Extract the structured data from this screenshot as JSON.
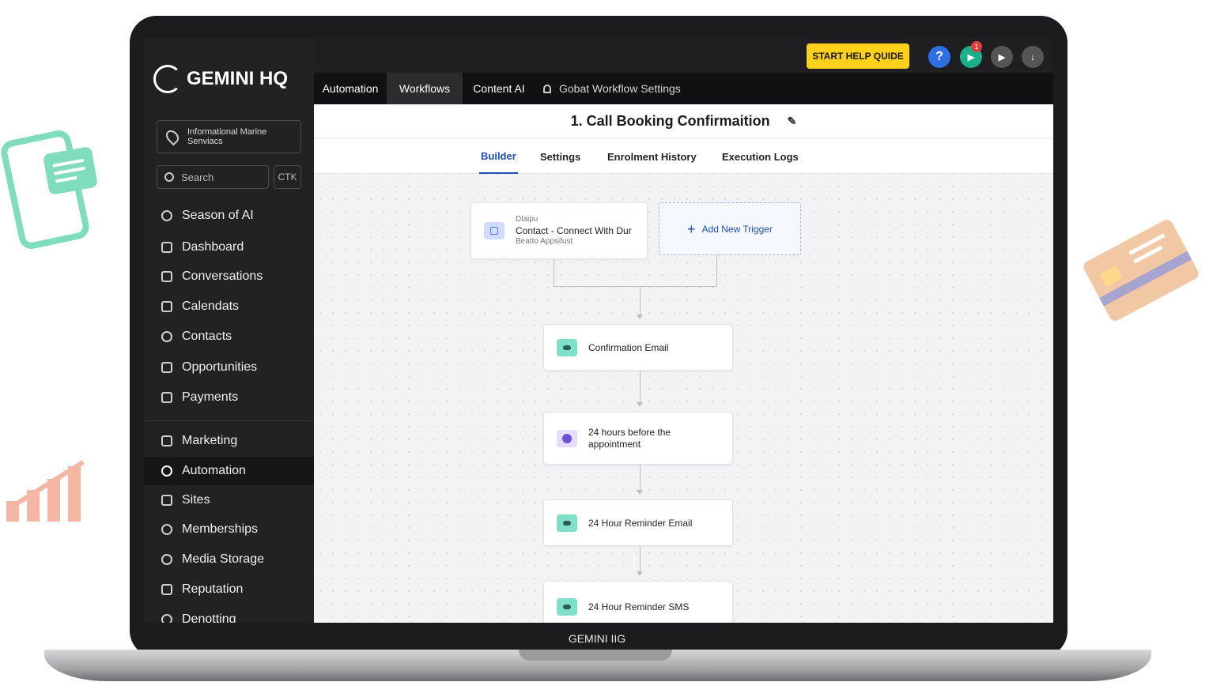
{
  "app": {
    "name": "GEMINI HQ",
    "laptop_label": "GEMINI IIG"
  },
  "topbar": {
    "help_button": "START HELP QUIDE",
    "notification_count": "1"
  },
  "sidebar": {
    "location": "Informational Marine Senviacs",
    "search_placeholder": "Search",
    "shortcut": "CTK",
    "items": [
      {
        "label": "Season of AI",
        "icon": "wifi-icon"
      },
      {
        "label": "Dashboard",
        "icon": "square-icon"
      },
      {
        "label": "Conversations",
        "icon": "square-icon"
      },
      {
        "label": "Calendats",
        "icon": "calendar-icon"
      },
      {
        "label": "Contacts",
        "icon": "person-icon"
      },
      {
        "label": "Opportunities",
        "icon": "square-icon"
      },
      {
        "label": "Payments",
        "icon": "monitor-icon"
      },
      {
        "label": "Marketing",
        "icon": "cart-icon"
      },
      {
        "label": "Automation",
        "icon": "circle-icon",
        "active": true
      },
      {
        "label": "Sites",
        "icon": "square-icon"
      },
      {
        "label": "Memberships",
        "icon": "person-icon"
      },
      {
        "label": "Media Storage",
        "icon": "pin-icon"
      },
      {
        "label": "Reputation",
        "icon": "square-icon"
      },
      {
        "label": "Denotting",
        "icon": "pin-icon"
      }
    ]
  },
  "mainnav": {
    "tabs": [
      "Automation",
      "Workflows",
      "Content AI"
    ],
    "settings_label": "Gobat Workflow Settings"
  },
  "workflow": {
    "title": "1. Call Booking Confirmaition",
    "subtabs": [
      "Builder",
      "Settings",
      "Enrolment History",
      "Execution Logs"
    ],
    "trigger": {
      "tag": "Dlaipu",
      "line1": "Contact - Connect With Dur",
      "line2": "Beatto Appsifust"
    },
    "add_trigger": "Add New Trigger",
    "steps": [
      "Confirmation Email",
      "24 hours before the appointment",
      "24 Hour Reminder Email",
      "24 Hour Reminder SMS"
    ]
  },
  "colors": {
    "accent": "#1e4fb8",
    "help_yellow": "#ffd11a",
    "teal": "#7fe0c9"
  }
}
